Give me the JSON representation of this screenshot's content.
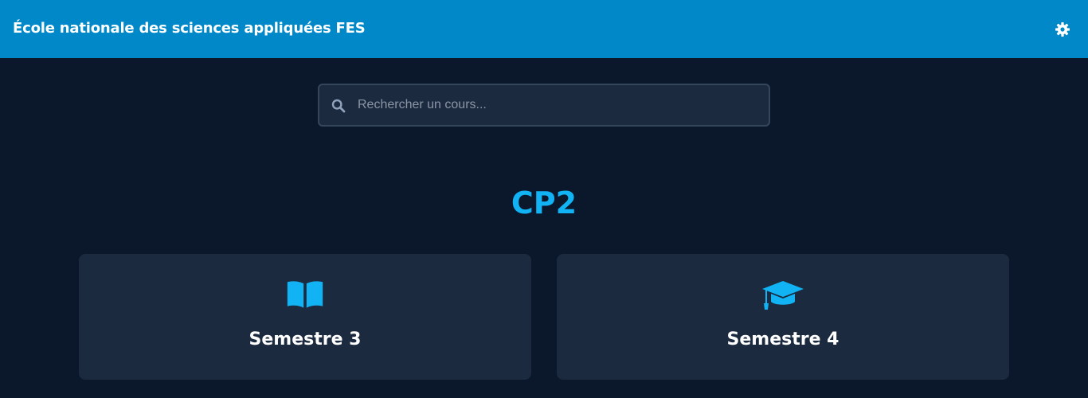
{
  "header": {
    "title": "École nationale des sciences appliquées FES",
    "settings_icon": "gear-icon"
  },
  "search": {
    "placeholder": "Rechercher un cours...",
    "value": "",
    "icon": "search-icon"
  },
  "section": {
    "title": "CP2"
  },
  "cards": [
    {
      "label": "Semestre 3",
      "icon": "open-book-icon"
    },
    {
      "label": "Semestre 4",
      "icon": "graduation-cap-icon"
    }
  ],
  "colors": {
    "header_bg": "#0088c8",
    "page_bg": "#0b182b",
    "card_bg": "#1b2a3f",
    "accent": "#12b3f5",
    "text": "#ffffff"
  }
}
